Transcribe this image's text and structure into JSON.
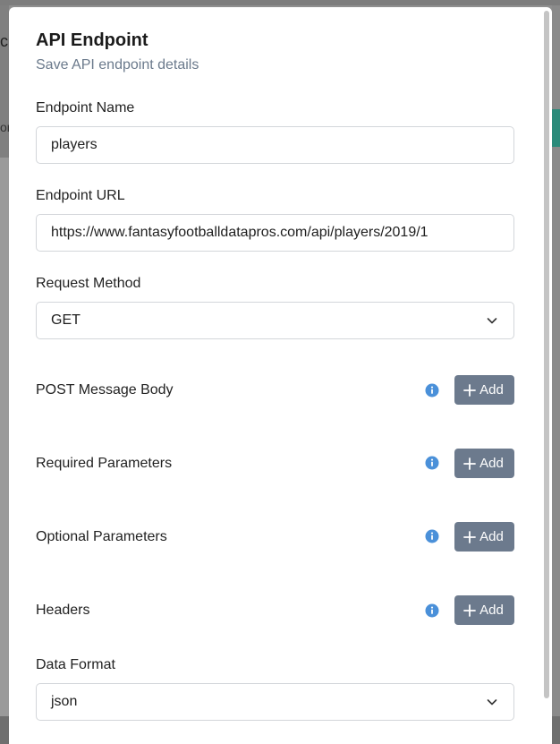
{
  "modal": {
    "title": "API Endpoint",
    "subtitle": "Save API endpoint details"
  },
  "background": {
    "left_glimpse": "c",
    "left_glimpse2": "or"
  },
  "form": {
    "endpoint_name": {
      "label": "Endpoint Name",
      "value": "players"
    },
    "endpoint_url": {
      "label": "Endpoint URL",
      "value": "https://www.fantasyfootballdatapros.com/api/players/2019/1"
    },
    "request_method": {
      "label": "Request Method",
      "value": "GET"
    },
    "post_body": {
      "label": "POST Message Body",
      "button": "Add"
    },
    "required_params": {
      "label": "Required Parameters",
      "button": "Add"
    },
    "optional_params": {
      "label": "Optional Parameters",
      "button": "Add"
    },
    "headers": {
      "label": "Headers",
      "button": "Add"
    },
    "data_format": {
      "label": "Data Format",
      "value": "json"
    }
  },
  "icons": {
    "info": "info-circle-icon",
    "plus": "plus-icon",
    "chevron": "chevron-down-icon"
  },
  "colors": {
    "add_button_bg": "#6c7a8d",
    "info_icon": "#4a90d9",
    "subtitle": "#6b7a8c"
  }
}
